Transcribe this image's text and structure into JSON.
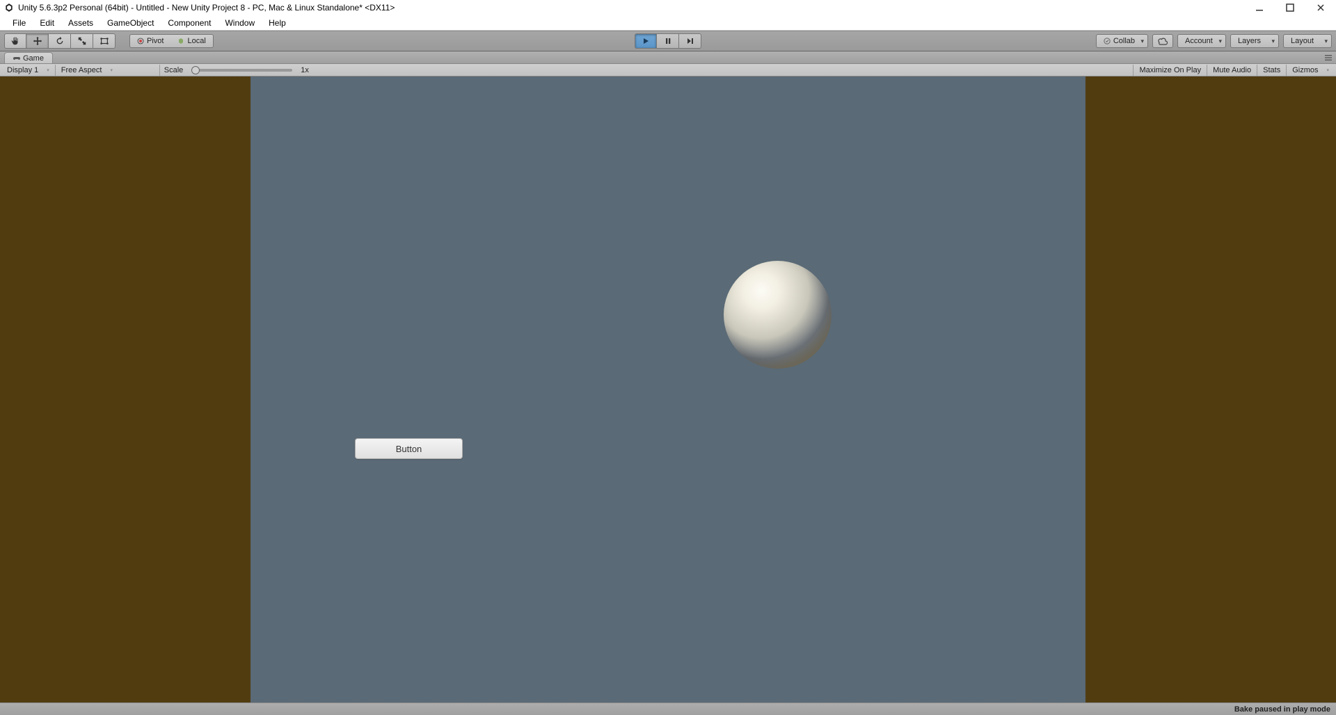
{
  "window": {
    "title": "Unity 5.6.3p2 Personal (64bit) - Untitled - New Unity Project 8 - PC, Mac & Linux Standalone* <DX11>"
  },
  "menu": {
    "items": [
      "File",
      "Edit",
      "Assets",
      "GameObject",
      "Component",
      "Window",
      "Help"
    ]
  },
  "toolbar": {
    "pivot": "Pivot",
    "local": "Local",
    "collab": "Collab",
    "account": "Account",
    "layers": "Layers",
    "layout": "Layout"
  },
  "tabs": {
    "game": "Game"
  },
  "game_toolbar": {
    "display": "Display 1",
    "aspect": "Free Aspect",
    "scale_label": "Scale",
    "scale_value": "1x",
    "maximize": "Maximize On Play",
    "mute": "Mute Audio",
    "stats": "Stats",
    "gizmos": "Gizmos"
  },
  "scene": {
    "button_label": "Button"
  },
  "statusbar": {
    "message": "Bake paused in play mode"
  }
}
